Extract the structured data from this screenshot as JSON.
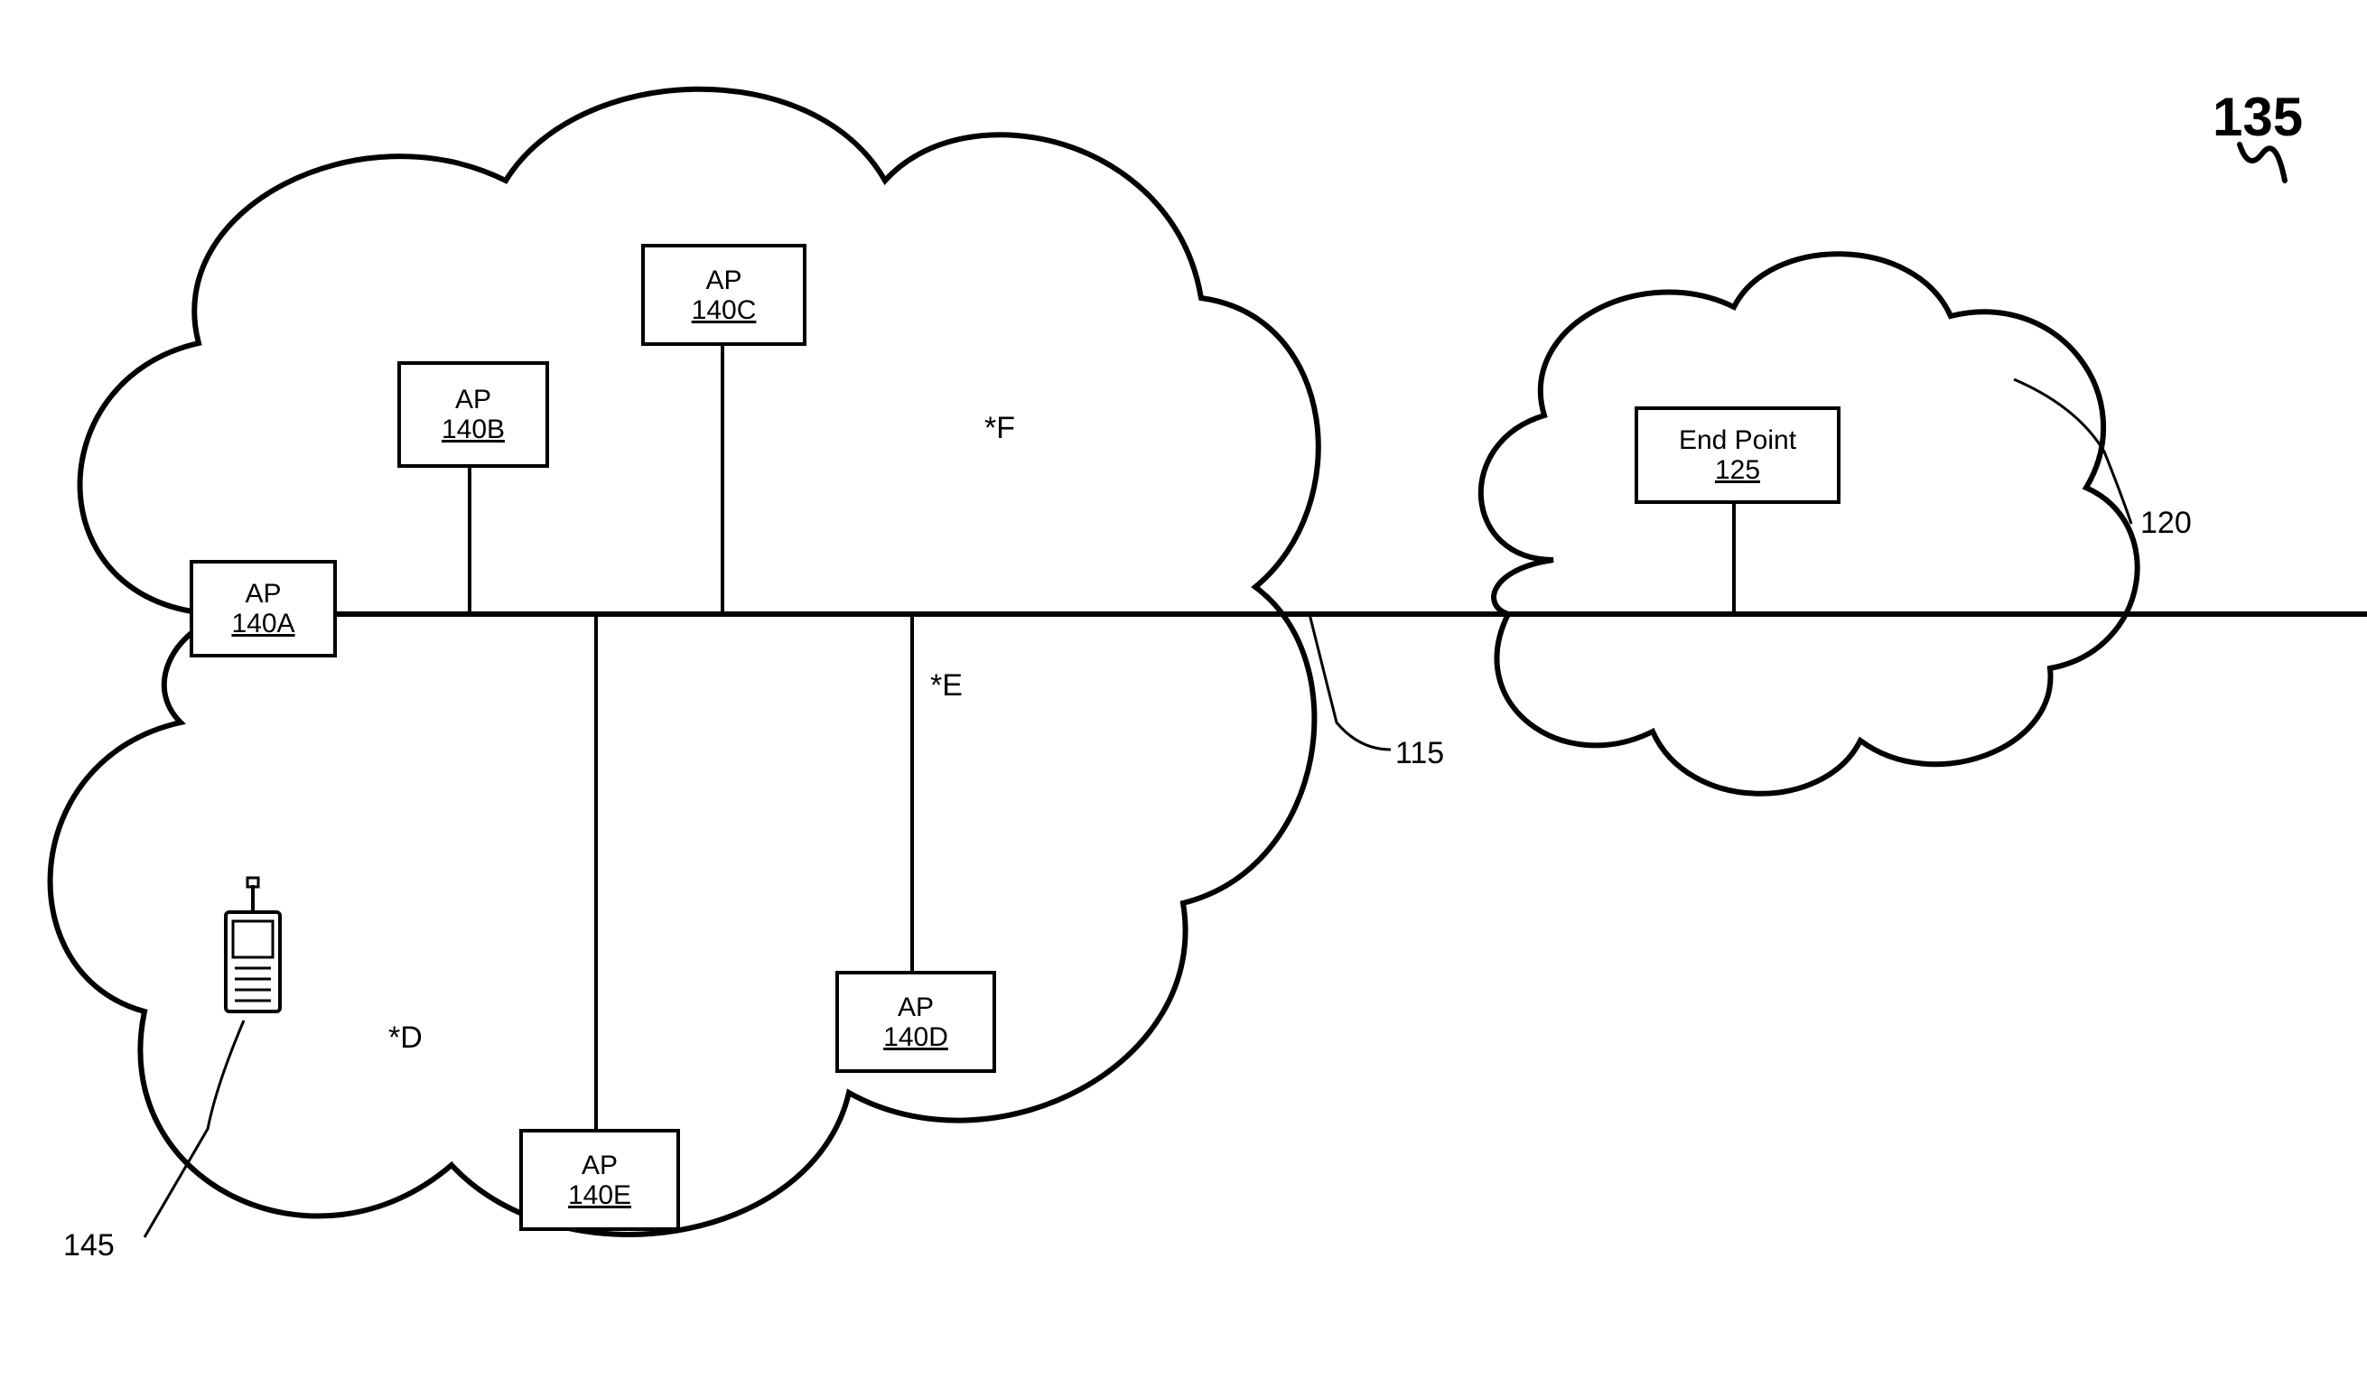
{
  "figure_number": "135",
  "boxes": {
    "ap_a": {
      "label": "AP",
      "num": "140A"
    },
    "ap_b": {
      "label": "AP",
      "num": "140B"
    },
    "ap_c": {
      "label": "AP",
      "num": "140C"
    },
    "ap_d": {
      "label": "AP",
      "num": "140D"
    },
    "ap_e": {
      "label": "AP",
      "num": "140E"
    },
    "endpoint": {
      "label": "End Point",
      "num": "125"
    }
  },
  "markers": {
    "d": "*D",
    "e": "*E",
    "f": "*F"
  },
  "callouts": {
    "c115": "115",
    "c120": "120",
    "c145": "145"
  }
}
